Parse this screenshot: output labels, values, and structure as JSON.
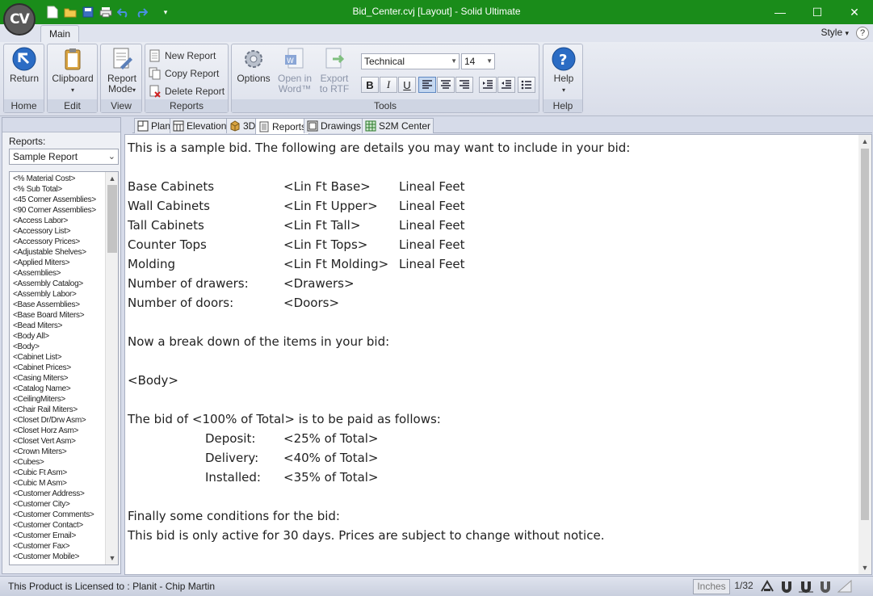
{
  "window": {
    "title": "Bid_Center.cvj [Layout] - Solid Ultimate",
    "logo_text": "CV",
    "controls": [
      "minimize-icon",
      "maximize-icon",
      "close-icon"
    ]
  },
  "quick_access": [
    "new-icon",
    "open-folder-icon",
    "save-icon",
    "print-icon",
    "undo-icon",
    "redo-icon",
    "customize-dropdown-icon"
  ],
  "ribbon": {
    "tab": "Main",
    "style_label": "Style",
    "groups": {
      "home": {
        "label": "Home",
        "return": "Return"
      },
      "edit": {
        "label": "Edit",
        "clipboard": "Clipboard"
      },
      "view": {
        "label": "View",
        "report_mode_1": "Report",
        "report_mode_2": "Mode"
      },
      "reports": {
        "label": "Reports",
        "new_report": "New Report",
        "copy_report": "Copy Report",
        "delete_report": "Delete Report"
      },
      "tools": {
        "label": "Tools",
        "options": "Options",
        "open_word_1": "Open in",
        "open_word_2": "Word™",
        "export_rtf_1": "Export",
        "export_rtf_2": "to RTF",
        "font_name": "Technical",
        "font_size": "14",
        "bold": "B",
        "italic": "I",
        "underline": "U"
      },
      "help": {
        "label": "Help",
        "help": "Help"
      }
    }
  },
  "left_panel": {
    "reports_label": "Reports:",
    "selected_report": "Sample Report",
    "fields": [
      "<% Material Cost>",
      "<% Sub Total>",
      "<45 Corner Assemblies>",
      "<90 Corner Assemblies>",
      "<Access Labor>",
      "<Accessory List>",
      "<Accessory Prices>",
      "<Adjustable Shelves>",
      "<Applied Miters>",
      "<Assemblies>",
      "<Assembly Catalog>",
      "<Assembly Labor>",
      "<Base Assemblies>",
      "<Base Board Miters>",
      "<Bead Miters>",
      "<Body All>",
      "<Body>",
      "<Cabinet List>",
      "<Cabinet Prices>",
      "<Casing Miters>",
      "<Catalog Name>",
      "<CeilingMiters>",
      "<Chair Rail Miters>",
      "<Closet Dr/Drw Asm>",
      "<Closet Horz Asm>",
      "<Closet Vert Asm>",
      "<Crown Miters>",
      "<Cubes>",
      "<Cubic Ft Asm>",
      "<Cubic M Asm>",
      "<Customer Address>",
      "<Customer City>",
      "<Customer Comments>",
      "<Customer Contact>",
      "<Customer Email>",
      "<Customer Fax>",
      "<Customer Mobile>"
    ]
  },
  "doc_tabs": [
    {
      "label": "Plan",
      "icon": "plan-icon"
    },
    {
      "label": "Elevation",
      "icon": "elevation-icon"
    },
    {
      "label": "3D",
      "icon": "3d-icon"
    },
    {
      "label": "Reports",
      "icon": "reports-icon",
      "active": true
    },
    {
      "label": "Drawings",
      "icon": "drawings-icon"
    },
    {
      "label": "S2M Center",
      "icon": "s2m-icon"
    }
  ],
  "document": {
    "intro": "This is a sample bid. The following are details you may want to include in your bid:",
    "rows": [
      {
        "label": "Base Cabinets",
        "field": "<Lin Ft Base>",
        "unit": "Lineal Feet"
      },
      {
        "label": "Wall Cabinets",
        "field": "<Lin Ft Upper>",
        "unit": "Lineal Feet"
      },
      {
        "label": "Tall Cabinets",
        "field": "<Lin Ft Tall>",
        "unit": "Lineal Feet"
      },
      {
        "label": "Counter Tops",
        "field": "<Lin Ft Tops>",
        "unit": "Lineal Feet"
      },
      {
        "label": "Molding",
        "field": "<Lin Ft Molding>",
        "unit": "Lineal Feet"
      },
      {
        "label": "Number of drawers:",
        "field": "<Drawers>",
        "unit": ""
      },
      {
        "label": "Number of doors:",
        "field": "<Doors>",
        "unit": ""
      }
    ],
    "breakdown": "Now a break down of the items in your bid:",
    "body_field": "<Body>",
    "payment_intro": "The bid of <100% of Total> is to be paid as follows:",
    "payments": [
      {
        "label": "Deposit:",
        "field": "<25% of Total>"
      },
      {
        "label": "Delivery:",
        "field": "<40% of Total>"
      },
      {
        "label": "Installed:",
        "field": "<35% of Total>"
      }
    ],
    "conditions_title": "Finally some conditions for the bid:",
    "conditions_text": "This bid is only active for 30 days. Prices are subject to change without notice."
  },
  "status_bar": {
    "license": "This Product is Licensed to : Planit - Chip Martin",
    "units": "Inches",
    "precision": "1/32"
  },
  "colors": {
    "titlebar": "#1a8c1a",
    "ribbon": "#dfe3ee",
    "accent": "#2b6cc4"
  }
}
